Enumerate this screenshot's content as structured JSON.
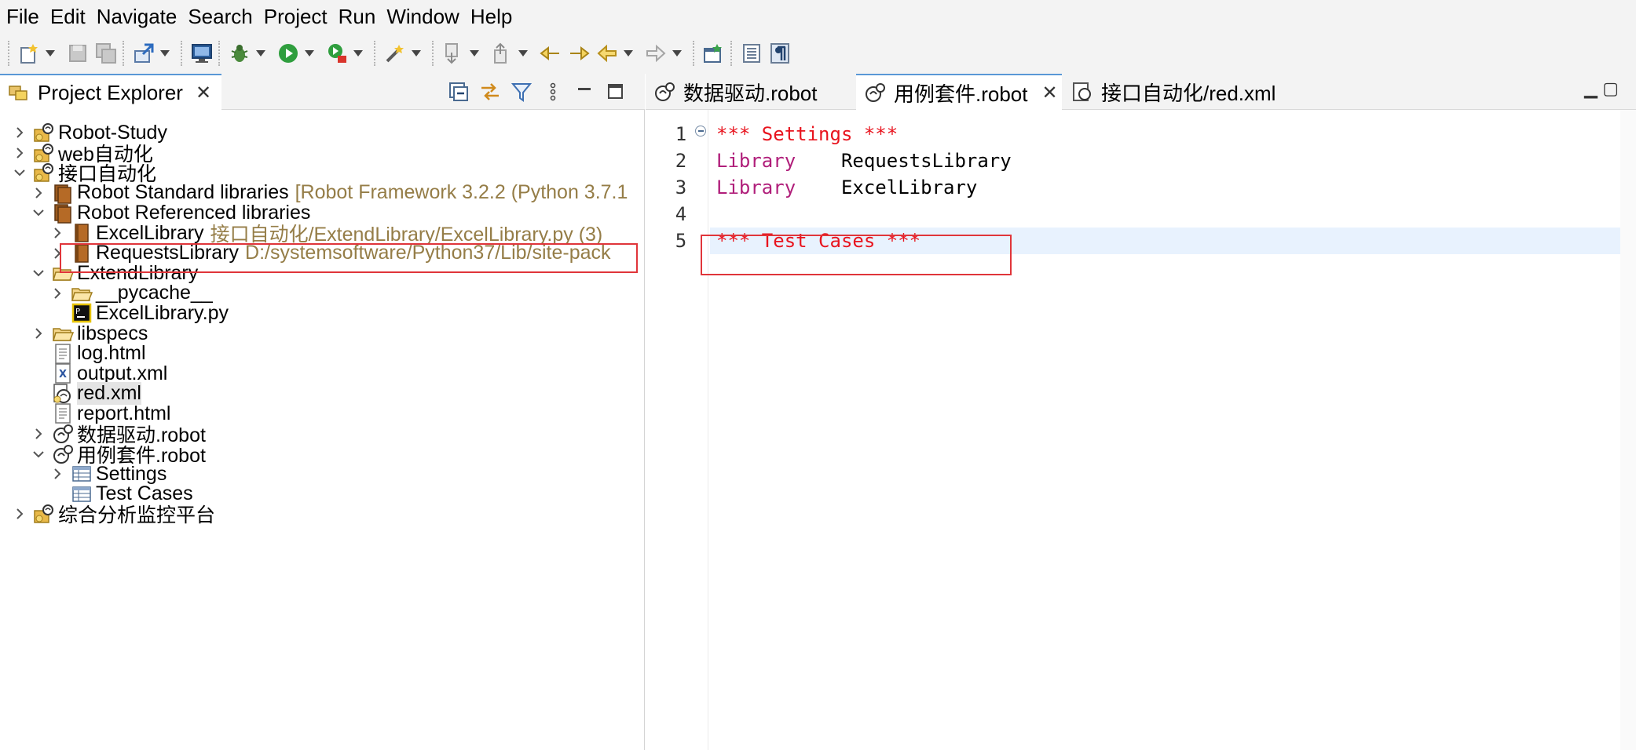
{
  "menu": [
    "File",
    "Edit",
    "Navigate",
    "Search",
    "Project",
    "Run",
    "Window",
    "Help"
  ],
  "project_explorer": {
    "tab_label": "Project Explorer",
    "close_glyph": "✕"
  },
  "tree": [
    {
      "name": "Robot-Study",
      "icon": "robot-project-icon",
      "expand": "collapsed"
    },
    {
      "name": "web自动化",
      "icon": "robot-project-icon",
      "expand": "collapsed"
    },
    {
      "name": "接口自动化",
      "icon": "robot-project-icon",
      "expand": "expanded"
    },
    {
      "name": "Robot Standard libraries",
      "dec": "[Robot Framework 3.2.2 (Python 3.7.1",
      "icon": "library-container-icon",
      "expand": "collapsed"
    },
    {
      "name": "Robot Referenced libraries",
      "icon": "library-container-icon",
      "expand": "expanded"
    },
    {
      "name": "ExcelLibrary",
      "dec": "接口自动化/ExtendLibrary/ExcelLibrary.py (3)",
      "icon": "library-icon",
      "expand": "collapsed"
    },
    {
      "name": "RequestsLibrary",
      "dec": "D:/systemsoftware/Python37/Lib/site-pack",
      "icon": "library-icon",
      "expand": "collapsed"
    },
    {
      "name": "ExtendLibrary",
      "icon": "folder-open-icon",
      "expand": "expanded"
    },
    {
      "name": "__pycache__",
      "icon": "folder-open-icon",
      "expand": "collapsed"
    },
    {
      "name": "ExcelLibrary.py",
      "icon": "python-file-icon",
      "expand": "none"
    },
    {
      "name": "libspecs",
      "icon": "folder-open-icon",
      "expand": "collapsed"
    },
    {
      "name": "log.html",
      "icon": "html-file-icon",
      "expand": "none"
    },
    {
      "name": "output.xml",
      "icon": "xml-file-icon",
      "expand": "none"
    },
    {
      "name": "red.xml",
      "icon": "red-config-icon",
      "expand": "none"
    },
    {
      "name": "report.html",
      "icon": "html-file-icon",
      "expand": "none"
    },
    {
      "name": "数据驱动.robot",
      "icon": "robot-file-icon",
      "expand": "collapsed"
    },
    {
      "name": "用例套件.robot",
      "icon": "robot-file-icon",
      "expand": "expanded"
    },
    {
      "name": "Settings",
      "icon": "table-icon",
      "expand": "collapsed"
    },
    {
      "name": "Test Cases",
      "icon": "table-icon",
      "expand": "none"
    },
    {
      "name": "综合分析监控平台",
      "icon": "robot-project-icon",
      "expand": "collapsed"
    }
  ],
  "editor": {
    "tabs": [
      {
        "label": "数据驱动.robot",
        "active": false
      },
      {
        "label": "用例套件.robot",
        "active": true,
        "close": "✕"
      },
      {
        "label": "接口自动化/red.xml",
        "active": false
      }
    ],
    "lines": [
      {
        "num": "1",
        "parts": [
          {
            "t": "*** Settings ***",
            "c": "sec"
          }
        ]
      },
      {
        "num": "2",
        "parts": [
          {
            "t": "Library",
            "c": "kw"
          },
          {
            "t": "    RequestsLibrary",
            "c": "plain"
          }
        ]
      },
      {
        "num": "3",
        "parts": [
          {
            "t": "Library",
            "c": "kw"
          },
          {
            "t": "    ExcelLibrary",
            "c": "plain"
          }
        ]
      },
      {
        "num": "4",
        "parts": []
      },
      {
        "num": "5",
        "parts": [
          {
            "t": "*** Test Cases ***",
            "c": "sec"
          }
        ]
      }
    ]
  },
  "colors": {
    "accent_tab": "#5a98d6",
    "decoration": "#957d47",
    "keyword": "#b01e7a",
    "section": "#e8141e",
    "highlight_box": "#e0353a",
    "current_line": "#e8f2fe"
  }
}
